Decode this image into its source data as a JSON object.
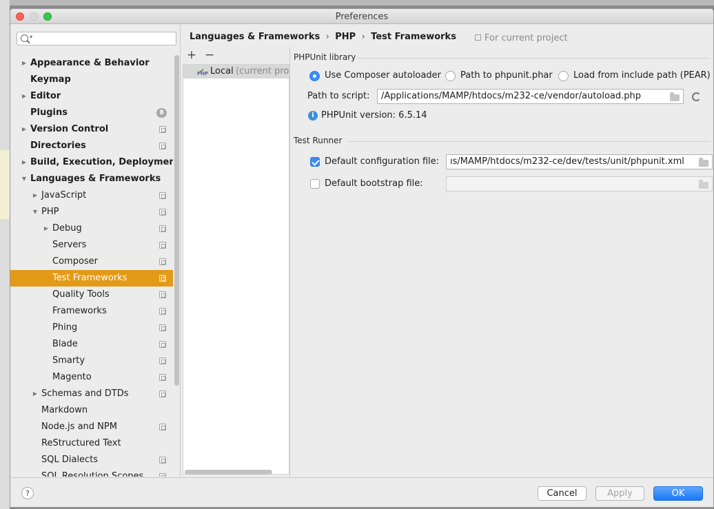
{
  "window": {
    "title": "Preferences"
  },
  "search": {
    "placeholder": ""
  },
  "sidebar": {
    "items": [
      {
        "label": "Appearance & Behavior",
        "bold": true,
        "arrow": "right",
        "indent": 0
      },
      {
        "label": "Keymap",
        "bold": true,
        "arrow": "",
        "indent": 0
      },
      {
        "label": "Editor",
        "bold": true,
        "arrow": "right",
        "indent": 0
      },
      {
        "label": "Plugins",
        "bold": true,
        "arrow": "",
        "indent": 0,
        "badge": "8"
      },
      {
        "label": "Version Control",
        "bold": true,
        "arrow": "right",
        "indent": 0,
        "icon": "project-scope-icon"
      },
      {
        "label": "Directories",
        "bold": true,
        "arrow": "",
        "indent": 0,
        "icon": "project-scope-icon"
      },
      {
        "label": "Build, Execution, Deployment",
        "bold": true,
        "arrow": "right",
        "indent": 0
      },
      {
        "label": "Languages & Frameworks",
        "bold": true,
        "arrow": "down",
        "indent": 0
      },
      {
        "label": "JavaScript",
        "bold": false,
        "arrow": "right",
        "indent": 1,
        "icon": "project-scope-icon"
      },
      {
        "label": "PHP",
        "bold": false,
        "arrow": "down",
        "indent": 1,
        "icon": "project-scope-icon"
      },
      {
        "label": "Debug",
        "bold": false,
        "arrow": "right",
        "indent": 2,
        "icon": "project-scope-icon"
      },
      {
        "label": "Servers",
        "bold": false,
        "arrow": "",
        "indent": 2,
        "icon": "project-scope-icon"
      },
      {
        "label": "Composer",
        "bold": false,
        "arrow": "",
        "indent": 2,
        "icon": "project-scope-icon"
      },
      {
        "label": "Test Frameworks",
        "bold": false,
        "arrow": "",
        "indent": 2,
        "icon": "project-scope-icon",
        "selected": true
      },
      {
        "label": "Quality Tools",
        "bold": false,
        "arrow": "",
        "indent": 2,
        "icon": "project-scope-icon"
      },
      {
        "label": "Frameworks",
        "bold": false,
        "arrow": "",
        "indent": 2,
        "icon": "project-scope-icon"
      },
      {
        "label": "Phing",
        "bold": false,
        "arrow": "",
        "indent": 2,
        "icon": "project-scope-icon"
      },
      {
        "label": "Blade",
        "bold": false,
        "arrow": "",
        "indent": 2,
        "icon": "project-scope-icon"
      },
      {
        "label": "Smarty",
        "bold": false,
        "arrow": "",
        "indent": 2,
        "icon": "project-scope-icon"
      },
      {
        "label": "Magento",
        "bold": false,
        "arrow": "",
        "indent": 2,
        "icon": "project-scope-icon"
      },
      {
        "label": "Schemas and DTDs",
        "bold": false,
        "arrow": "right",
        "indent": 1,
        "icon": "project-scope-icon"
      },
      {
        "label": "Markdown",
        "bold": false,
        "arrow": "",
        "indent": 1
      },
      {
        "label": "Node.js and NPM",
        "bold": false,
        "arrow": "",
        "indent": 1,
        "icon": "project-scope-icon"
      },
      {
        "label": "ReStructured Text",
        "bold": false,
        "arrow": "",
        "indent": 1
      },
      {
        "label": "SQL Dialects",
        "bold": false,
        "arrow": "",
        "indent": 1,
        "icon": "project-scope-icon"
      },
      {
        "label": "SQL Resolution Scopes",
        "bold": false,
        "arrow": "",
        "indent": 1,
        "icon": "project-scope-icon"
      }
    ]
  },
  "breadcrumb": {
    "items": [
      "Languages & Frameworks",
      "PHP",
      "Test Frameworks"
    ],
    "separator": "›",
    "scope_note": "For current project"
  },
  "list_toolbar": {
    "add": "+",
    "remove": "−"
  },
  "interpreters": {
    "items": [
      {
        "name": "Local",
        "note": "(current project)",
        "icon_text": "PHP"
      }
    ]
  },
  "phpunit": {
    "section_title": "PHPUnit library",
    "options": [
      {
        "label": "Use Composer autoloader",
        "selected": true
      },
      {
        "label": "Path to phpunit.phar",
        "selected": false
      },
      {
        "label": "Load from include path (PEAR)",
        "selected": false
      }
    ],
    "path_label": "Path to script:",
    "path_value": "/Applications/MAMP/htdocs/m232-ce/vendor/autoload.php",
    "version_text": "PHPUnit version: 6.5.14"
  },
  "test_runner": {
    "section_title": "Test Runner",
    "config_label": "Default configuration file:",
    "config_checked": true,
    "config_value": "ıs/MAMP/htdocs/m232-ce/dev/tests/unit/phpunit.xml",
    "bootstrap_label": "Default bootstrap file:",
    "bootstrap_checked": false,
    "bootstrap_value": ""
  },
  "footer": {
    "help": "?",
    "cancel": "Cancel",
    "apply": "Apply",
    "ok": "OK"
  },
  "colors": {
    "selection": "#e39a17",
    "accent": "#3b8cf3"
  }
}
